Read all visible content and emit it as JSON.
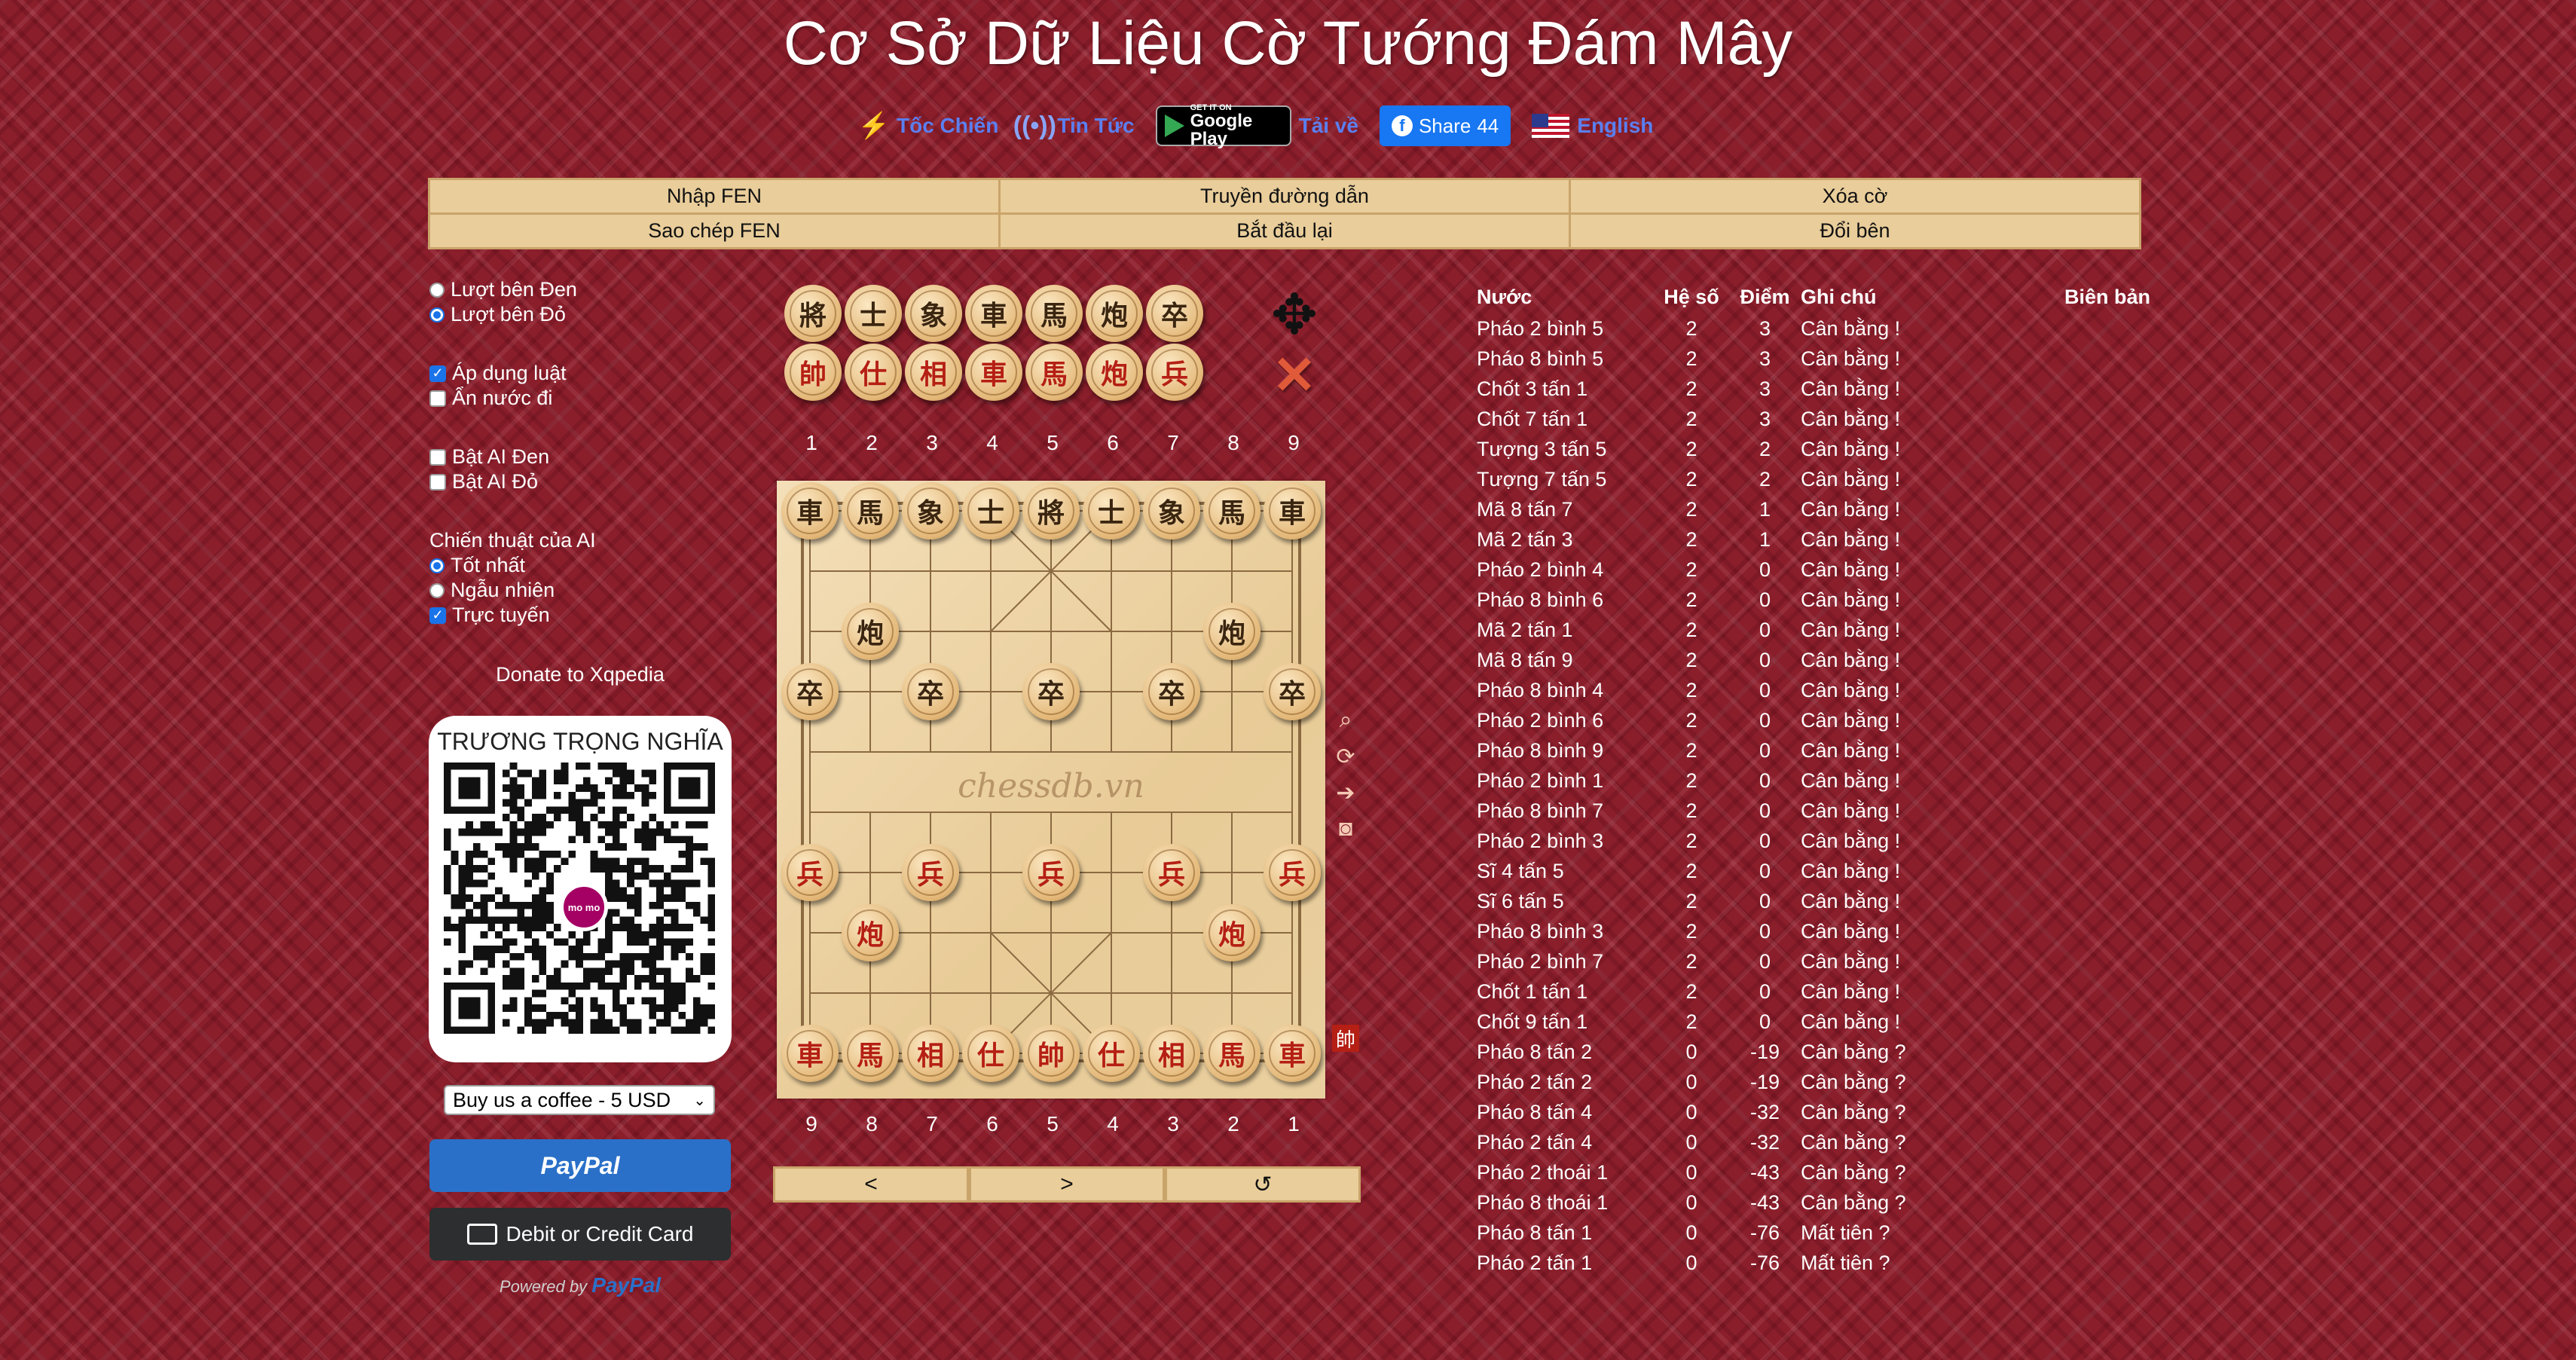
{
  "title": "Cơ Sở Dữ Liệu Cờ Tướng Đám Mây",
  "toplinks": {
    "toc_chien": "Tốc Chiến",
    "tin_tuc": "Tin Tức",
    "gplay_small": "GET IT ON",
    "gplay_big": "Google Play",
    "tai_ve": "Tải về",
    "share_label": "Share",
    "share_count": "44",
    "english": "English"
  },
  "controls": {
    "row1": [
      "Nhập FEN",
      "Truyền đường dẫn",
      "Xóa cờ"
    ],
    "row2": [
      "Sao chép FEN",
      "Bắt đầu lại",
      "Đổi bên"
    ]
  },
  "options": {
    "turn_black": "Lượt bên Đen",
    "turn_red": "Lượt bên Đỏ",
    "turn_selected": "red",
    "apply_rules": "Áp dụng luật",
    "apply_rules_checked": true,
    "hide_moves": "Ẩn nước đi",
    "hide_moves_checked": false,
    "ai_black": "Bật AI Đen",
    "ai_black_checked": false,
    "ai_red": "Bật AI Đỏ",
    "ai_red_checked": false,
    "ai_strategy_label": "Chiến thuật của AI",
    "strat_best": "Tốt nhất",
    "strat_random": "Ngẫu nhiên",
    "strat_online": "Trực tuyến",
    "strat_selected": "best",
    "strat_online_checked": true
  },
  "donate": {
    "label": "Donate to Xqpedia",
    "qr_name": "TRƯƠNG TRỌNG NGHĨA",
    "momo_text": "mo mo",
    "select_value": "Buy us a coffee - 5 USD",
    "paypal": "PayPal",
    "card": "Debit or Credit Card",
    "powered_by": "Powered by",
    "powered_brand": "PayPal"
  },
  "palette": {
    "black_pieces": [
      "將",
      "士",
      "象",
      "車",
      "馬",
      "炮",
      "卒"
    ],
    "red_pieces": [
      "帥",
      "仕",
      "相",
      "車",
      "馬",
      "炮",
      "兵"
    ],
    "move_icon": "✥",
    "delete_icon": "✕"
  },
  "top_numbers": [
    "1",
    "2",
    "3",
    "4",
    "5",
    "6",
    "7",
    "8",
    "9"
  ],
  "bottom_numbers": [
    "9",
    "8",
    "7",
    "6",
    "5",
    "4",
    "3",
    "2",
    "1"
  ],
  "board": {
    "watermark": "chessdb.vn",
    "pieces": [
      {
        "f": 0,
        "r": 0,
        "ch": "車",
        "side": "black"
      },
      {
        "f": 1,
        "r": 0,
        "ch": "馬",
        "side": "black"
      },
      {
        "f": 2,
        "r": 0,
        "ch": "象",
        "side": "black"
      },
      {
        "f": 3,
        "r": 0,
        "ch": "士",
        "side": "black"
      },
      {
        "f": 4,
        "r": 0,
        "ch": "將",
        "side": "black"
      },
      {
        "f": 5,
        "r": 0,
        "ch": "士",
        "side": "black"
      },
      {
        "f": 6,
        "r": 0,
        "ch": "象",
        "side": "black"
      },
      {
        "f": 7,
        "r": 0,
        "ch": "馬",
        "side": "black"
      },
      {
        "f": 8,
        "r": 0,
        "ch": "車",
        "side": "black"
      },
      {
        "f": 1,
        "r": 2,
        "ch": "炮",
        "side": "black"
      },
      {
        "f": 7,
        "r": 2,
        "ch": "炮",
        "side": "black"
      },
      {
        "f": 0,
        "r": 3,
        "ch": "卒",
        "side": "black"
      },
      {
        "f": 2,
        "r": 3,
        "ch": "卒",
        "side": "black"
      },
      {
        "f": 4,
        "r": 3,
        "ch": "卒",
        "side": "black"
      },
      {
        "f": 6,
        "r": 3,
        "ch": "卒",
        "side": "black"
      },
      {
        "f": 8,
        "r": 3,
        "ch": "卒",
        "side": "black"
      },
      {
        "f": 0,
        "r": 6,
        "ch": "兵",
        "side": "red"
      },
      {
        "f": 2,
        "r": 6,
        "ch": "兵",
        "side": "red"
      },
      {
        "f": 4,
        "r": 6,
        "ch": "兵",
        "side": "red"
      },
      {
        "f": 6,
        "r": 6,
        "ch": "兵",
        "side": "red"
      },
      {
        "f": 8,
        "r": 6,
        "ch": "兵",
        "side": "red"
      },
      {
        "f": 1,
        "r": 7,
        "ch": "炮",
        "side": "red"
      },
      {
        "f": 7,
        "r": 7,
        "ch": "炮",
        "side": "red"
      },
      {
        "f": 0,
        "r": 9,
        "ch": "車",
        "side": "red"
      },
      {
        "f": 1,
        "r": 9,
        "ch": "馬",
        "side": "red"
      },
      {
        "f": 2,
        "r": 9,
        "ch": "相",
        "side": "red"
      },
      {
        "f": 3,
        "r": 9,
        "ch": "仕",
        "side": "red"
      },
      {
        "f": 4,
        "r": 9,
        "ch": "帥",
        "side": "red"
      },
      {
        "f": 5,
        "r": 9,
        "ch": "仕",
        "side": "red"
      },
      {
        "f": 6,
        "r": 9,
        "ch": "相",
        "side": "red"
      },
      {
        "f": 7,
        "r": 9,
        "ch": "馬",
        "side": "red"
      },
      {
        "f": 8,
        "r": 9,
        "ch": "車",
        "side": "red"
      }
    ]
  },
  "side_tools": {
    "search": "⌕",
    "rotate": "⟳",
    "forward": "➔",
    "camera": "◙",
    "turn_marker": "帥"
  },
  "nav": {
    "prev": "<",
    "next": ">",
    "undo": "↺"
  },
  "moves": {
    "headers": {
      "move": "Nước",
      "rank": "Hệ số",
      "score": "Điểm",
      "note": "Ghi chú",
      "record": "Biên bản"
    },
    "rows": [
      [
        "Pháo 2 bình 5",
        "2",
        "3",
        "Cân bằng !"
      ],
      [
        "Pháo 8 bình 5",
        "2",
        "3",
        "Cân bằng !"
      ],
      [
        "Chốt 3 tấn 1",
        "2",
        "3",
        "Cân bằng !"
      ],
      [
        "Chốt 7 tấn 1",
        "2",
        "3",
        "Cân bằng !"
      ],
      [
        "Tượng 3 tấn 5",
        "2",
        "2",
        "Cân bằng !"
      ],
      [
        "Tượng 7 tấn 5",
        "2",
        "2",
        "Cân bằng !"
      ],
      [
        "Mã 8 tấn 7",
        "2",
        "1",
        "Cân bằng !"
      ],
      [
        "Mã 2 tấn 3",
        "2",
        "1",
        "Cân bằng !"
      ],
      [
        "Pháo 2 bình 4",
        "2",
        "0",
        "Cân bằng !"
      ],
      [
        "Pháo 8 bình 6",
        "2",
        "0",
        "Cân bằng !"
      ],
      [
        "Mã 2 tấn 1",
        "2",
        "0",
        "Cân bằng !"
      ],
      [
        "Mã 8 tấn 9",
        "2",
        "0",
        "Cân bằng !"
      ],
      [
        "Pháo 8 bình 4",
        "2",
        "0",
        "Cân bằng !"
      ],
      [
        "Pháo 2 bình 6",
        "2",
        "0",
        "Cân bằng !"
      ],
      [
        "Pháo 8 bình 9",
        "2",
        "0",
        "Cân bằng !"
      ],
      [
        "Pháo 2 bình 1",
        "2",
        "0",
        "Cân bằng !"
      ],
      [
        "Pháo 8 bình 7",
        "2",
        "0",
        "Cân bằng !"
      ],
      [
        "Pháo 2 bình 3",
        "2",
        "0",
        "Cân bằng !"
      ],
      [
        "Sĩ 4 tấn 5",
        "2",
        "0",
        "Cân bằng !"
      ],
      [
        "Sĩ 6 tấn 5",
        "2",
        "0",
        "Cân bằng !"
      ],
      [
        "Pháo 8 bình 3",
        "2",
        "0",
        "Cân bằng !"
      ],
      [
        "Pháo 2 bình 7",
        "2",
        "0",
        "Cân bằng !"
      ],
      [
        "Chốt 1 tấn 1",
        "2",
        "0",
        "Cân bằng !"
      ],
      [
        "Chốt 9 tấn 1",
        "2",
        "0",
        "Cân bằng !"
      ],
      [
        "Pháo 8 tấn 2",
        "0",
        "-19",
        "Cân bằng ?"
      ],
      [
        "Pháo 2 tấn 2",
        "0",
        "-19",
        "Cân bằng ?"
      ],
      [
        "Pháo 8 tấn 4",
        "0",
        "-32",
        "Cân bằng ?"
      ],
      [
        "Pháo 2 tấn 4",
        "0",
        "-32",
        "Cân bằng ?"
      ],
      [
        "Pháo 2 thoái 1",
        "0",
        "-43",
        "Cân bằng ?"
      ],
      [
        "Pháo 8 thoái 1",
        "0",
        "-43",
        "Cân bằng ?"
      ],
      [
        "Pháo 8 tấn 1",
        "0",
        "-76",
        "Mất tiên ?"
      ],
      [
        "Pháo 2 tấn 1",
        "0",
        "-76",
        "Mất tiên ?"
      ]
    ]
  },
  "colors": {
    "background": "#8a1e2b",
    "button_bg": "#e9cd9a",
    "link": "#5b7ff0",
    "red_piece": "#b51f14",
    "black_piece": "#3a2510"
  }
}
